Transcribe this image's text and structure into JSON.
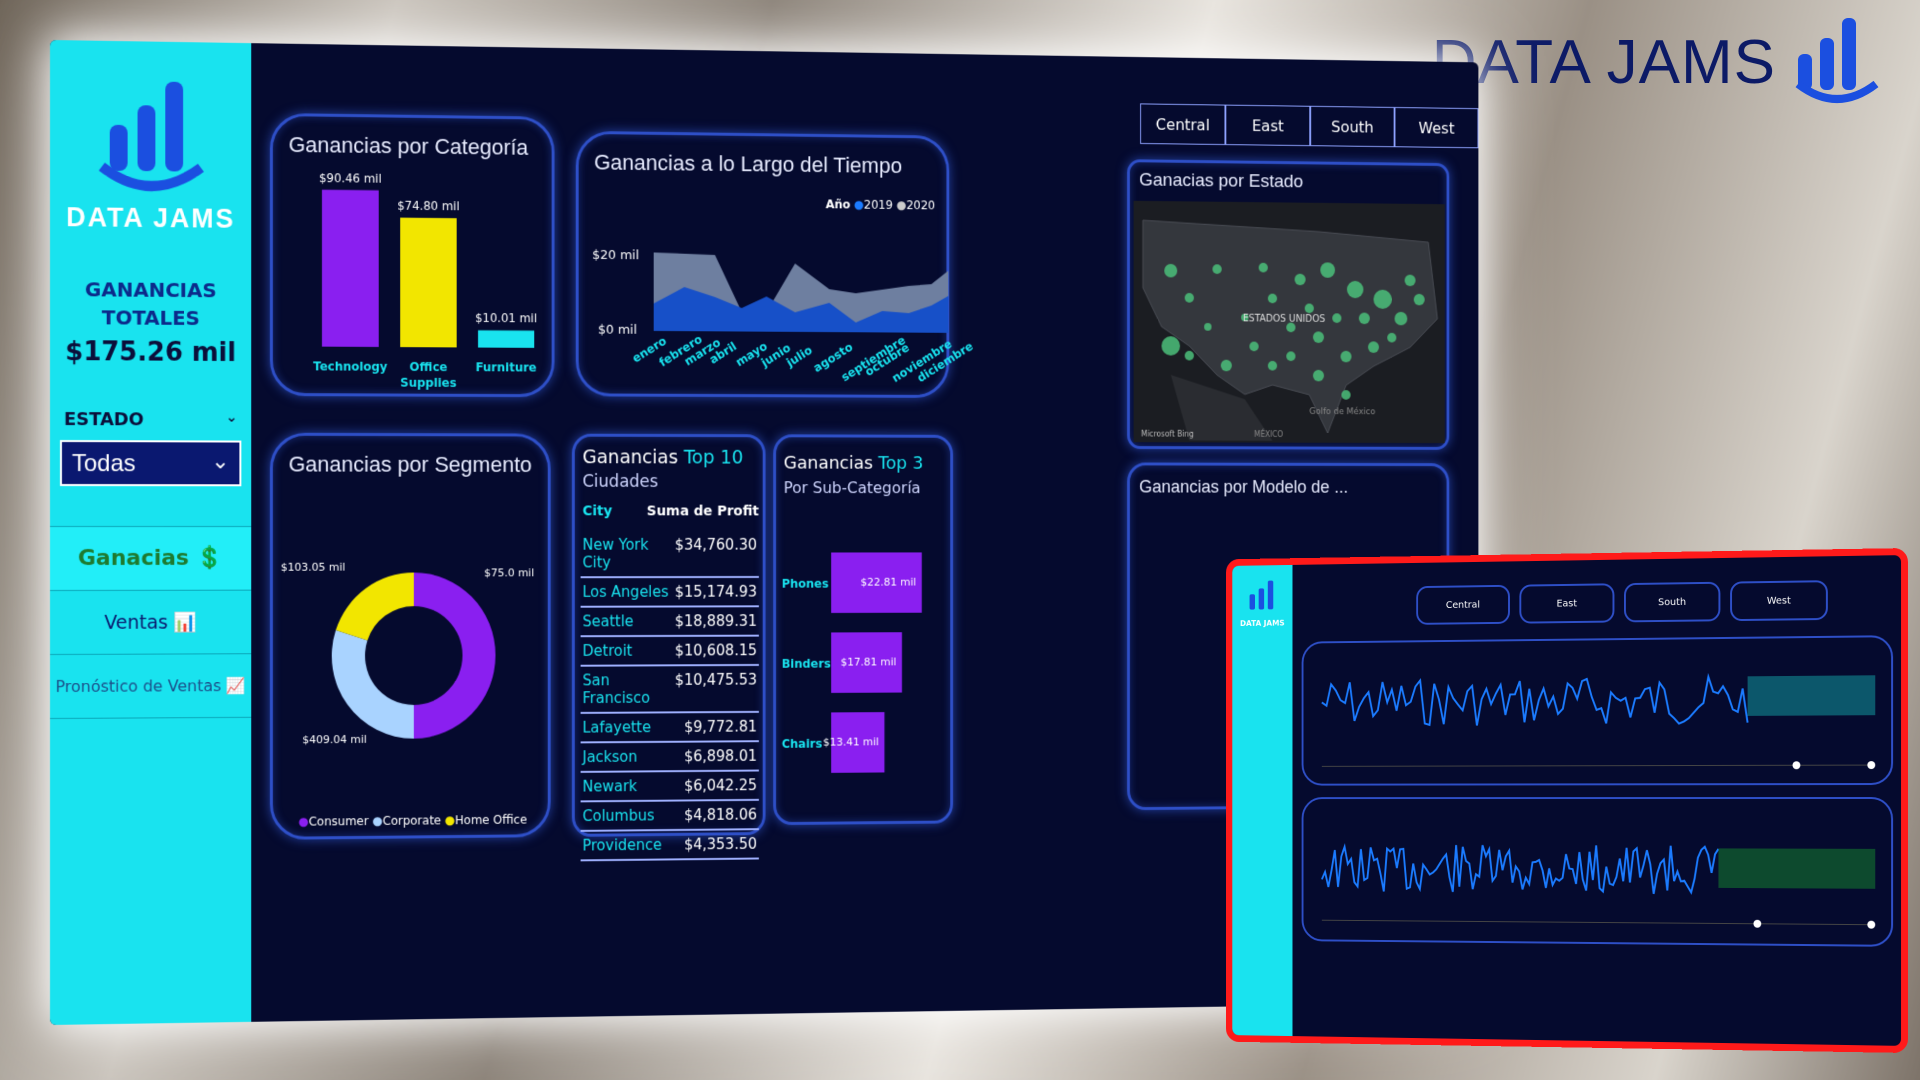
{
  "brand": {
    "name": "DATA JAMS"
  },
  "sidebar": {
    "brand": "DATA JAMS",
    "kpi_label_1": "GANANCIAS",
    "kpi_label_2": "TOTALES",
    "kpi_value": "$175.26 mil",
    "filter_label": "ESTADO",
    "filter_value": "Todas",
    "nav": [
      "Ganacias 💲",
      "Ventas 📊",
      "Pronóstico de Ventas 📈"
    ]
  },
  "card_category": {
    "title": "Ganancias por Categoría",
    "bars": [
      {
        "label": "Technology",
        "value_label": "$90.46 mil",
        "value": 90.46,
        "color": "#8a1ff0"
      },
      {
        "label": "Office Supplies",
        "value_label": "$74.80 mil",
        "value": 74.8,
        "color": "#f2e600"
      },
      {
        "label": "Furniture",
        "value_label": "$10.01 mil",
        "value": 10.01,
        "color": "#19e3ef"
      }
    ]
  },
  "card_time": {
    "title": "Ganancias a lo Largo del Tiempo",
    "legend_title": "Año",
    "legend": [
      "2019",
      "2020"
    ],
    "y_ticks": [
      "$20 mil",
      "$0 mil"
    ],
    "months": [
      "enero",
      "febrero",
      "marzo",
      "abril",
      "mayo",
      "junio",
      "julio",
      "agosto",
      "septiembre",
      "octubre",
      "noviembre",
      "diciembre"
    ]
  },
  "card_segment": {
    "title": "Ganancias por Segmento",
    "labels": [
      "$103.05 mil",
      "$75.0 mil",
      "$409.04 mil"
    ],
    "legend": [
      "Consumer",
      "Corporate",
      "Home Office"
    ],
    "colors": [
      "#8a1ff0",
      "#a9d3ff",
      "#f2e600"
    ]
  },
  "card_cities": {
    "title_a": "Ganancias ",
    "title_b": "Top 10",
    "subtitle": "Ciudades",
    "col_city": "City",
    "col_profit": "Suma de Profit",
    "rows": [
      {
        "city": "New York City",
        "profit": "$34,760.30"
      },
      {
        "city": "Los Angeles",
        "profit": "$15,174.93"
      },
      {
        "city": "Seattle",
        "profit": "$18,889.31"
      },
      {
        "city": "Detroit",
        "profit": "$10,608.15"
      },
      {
        "city": "San Francisco",
        "profit": "$10,475.53"
      },
      {
        "city": "Lafayette",
        "profit": "$9,772.81"
      },
      {
        "city": "Jackson",
        "profit": "$6,898.01"
      },
      {
        "city": "Newark",
        "profit": "$6,042.25"
      },
      {
        "city": "Columbus",
        "profit": "$4,818.06"
      },
      {
        "city": "Providence",
        "profit": "$4,353.50"
      }
    ]
  },
  "card_subcat": {
    "title_a": "Ganancias ",
    "title_b": "Top 3",
    "subtitle": "Por Sub-Categoría",
    "bars": [
      {
        "label": "Phones",
        "value_label": "$22.81 mil",
        "value": 22.81
      },
      {
        "label": "Binders",
        "value_label": "$17.81 mil",
        "value": 17.81
      },
      {
        "label": "Chairs",
        "value_label": "$13.41 mil",
        "value": 13.41
      }
    ]
  },
  "tabs": [
    "Central",
    "East",
    "South",
    "West"
  ],
  "card_map": {
    "title": "Ganacias por Estado",
    "country": "ESTADOS UNIDOS",
    "sea": "Golfo de México",
    "mexico": "MÉXICO",
    "credit": "Microsoft Bing"
  },
  "card_model": {
    "title": "Ganancias por Modelo de ..."
  },
  "inset": {
    "tabs": [
      "Central",
      "East",
      "South",
      "West"
    ],
    "brand": "DATA JAMS"
  }
}
